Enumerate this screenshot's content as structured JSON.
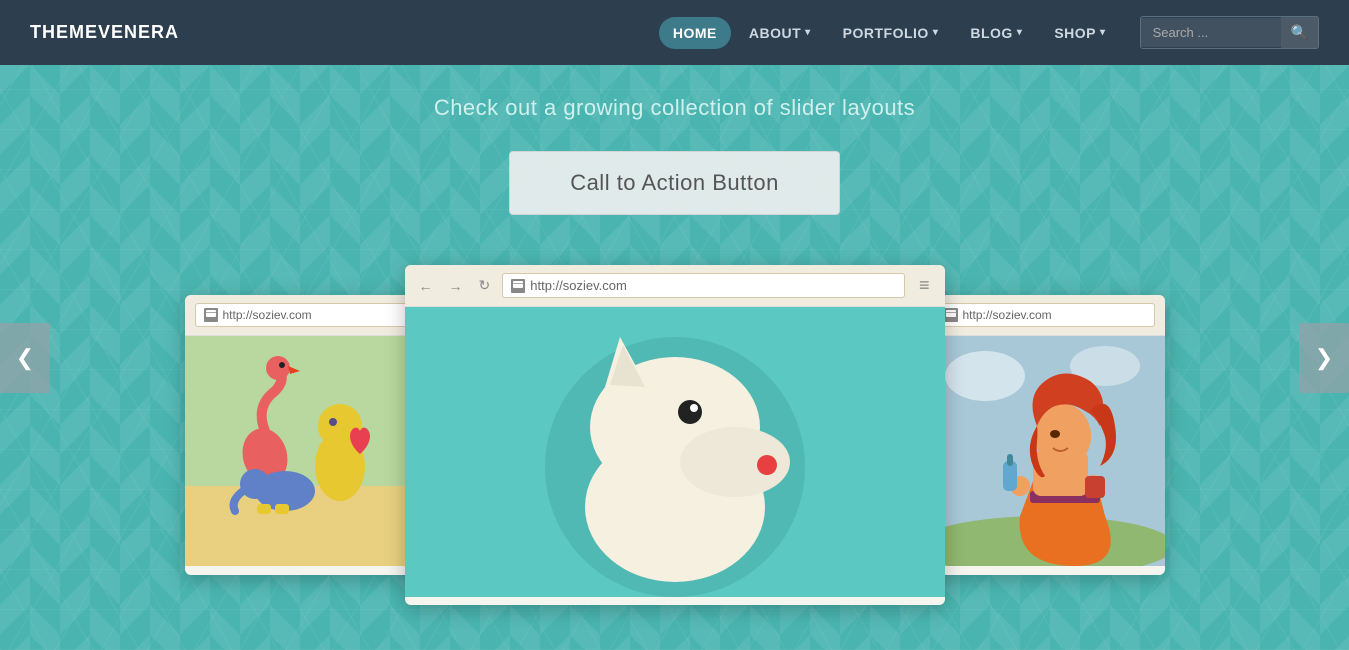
{
  "brand": "THEMEVENERA",
  "nav": {
    "items": [
      {
        "id": "home",
        "label": "HOME",
        "active": true,
        "hasDropdown": false
      },
      {
        "id": "about",
        "label": "ABOUT",
        "active": false,
        "hasDropdown": true
      },
      {
        "id": "portfolio",
        "label": "PORTFOLIO",
        "active": false,
        "hasDropdown": true
      },
      {
        "id": "blog",
        "label": "BLOG",
        "active": false,
        "hasDropdown": true
      },
      {
        "id": "shop",
        "label": "SHOP",
        "active": false,
        "hasDropdown": true
      }
    ],
    "search_placeholder": "Search ..."
  },
  "hero": {
    "subtitle": "Check out a growing collection of slider layouts",
    "cta_label": "Call to Action Button",
    "arrow_left": "❮",
    "arrow_right": "❯"
  },
  "browser": {
    "url": "http://soziev.com",
    "url_left": "http://soziev.com",
    "url_right": "http://soziev.com",
    "nav_back": "←",
    "nav_forward": "→",
    "nav_reload": "↻",
    "menu": "≡"
  }
}
